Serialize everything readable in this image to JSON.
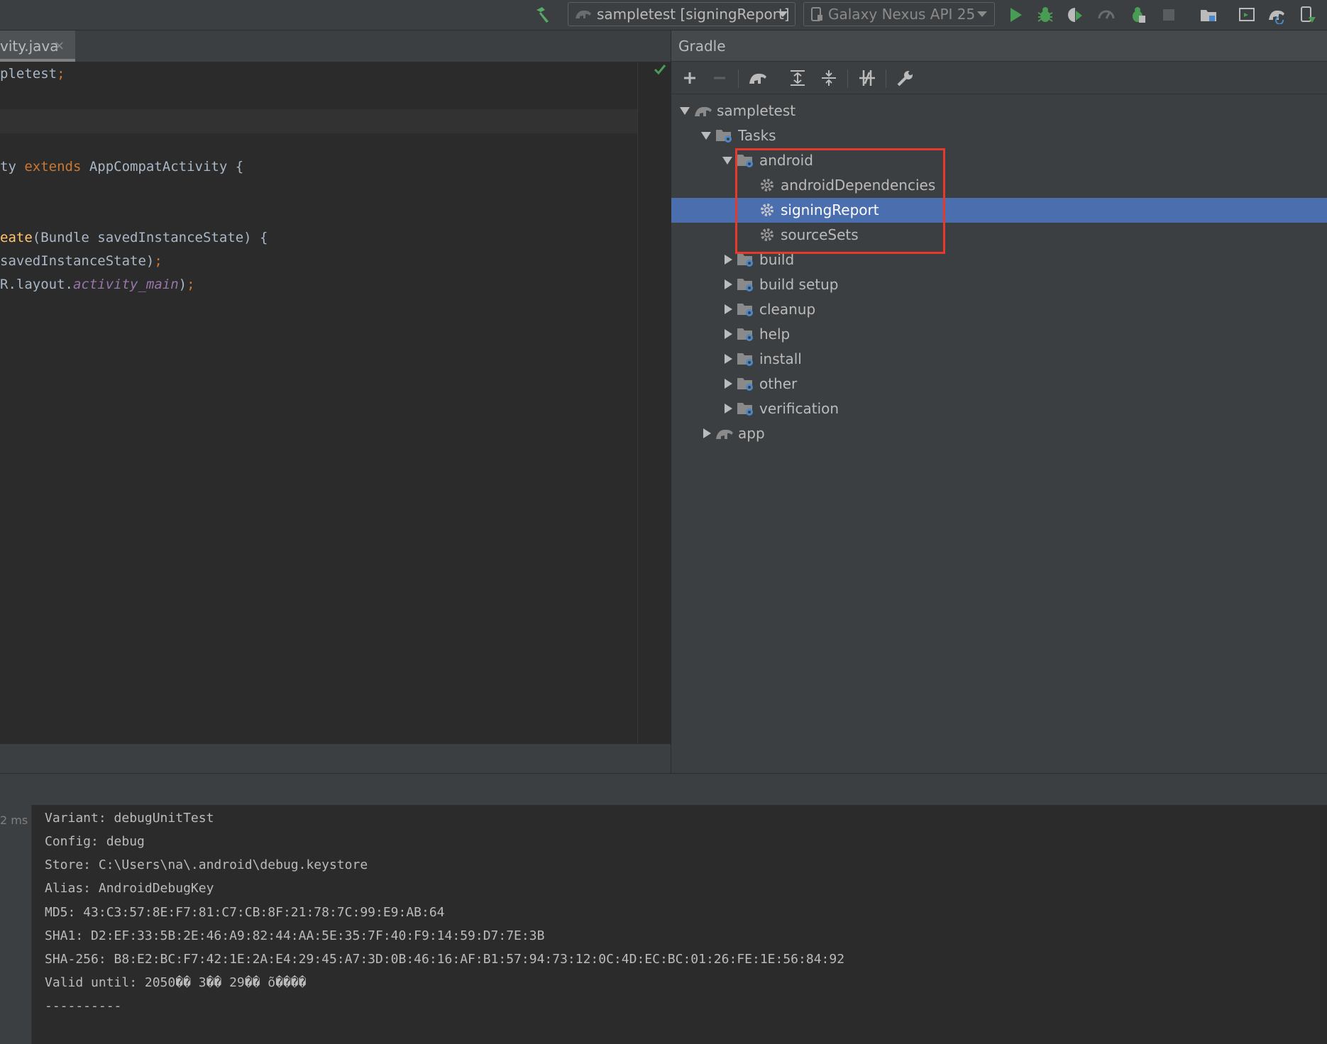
{
  "toolbar": {
    "run_config": "sampletest [signingReport]",
    "device": "Galaxy Nexus API 25"
  },
  "tab": {
    "label": "vity.java",
    "close": "×"
  },
  "editor": {
    "line1": {
      "a": "pletest",
      "b": ";"
    },
    "line2": {
      "a": "ty ",
      "kw": "extends",
      "b": " AppCompatActivity {"
    },
    "line3": {
      "fn": "eate",
      "b": "(Bundle savedInstanceState) {"
    },
    "line4": {
      "a": "savedInstanceState)",
      "b": ";"
    },
    "line5": {
      "a": "R.layout.",
      "it": "activity_main",
      "b": ")",
      "c": ";"
    }
  },
  "gradle": {
    "title": "Gradle",
    "tree": {
      "root": "sampletest",
      "tasks": "Tasks",
      "android": "android",
      "android_children": [
        "androidDependencies",
        "signingReport",
        "sourceSets"
      ],
      "groups": [
        "build",
        "build setup",
        "cleanup",
        "help",
        "install",
        "other",
        "verification"
      ],
      "app": "app"
    },
    "selected": "signingReport"
  },
  "console": {
    "timing": "2 ms",
    "lines": [
      "Variant: debugUnitTest",
      "Config: debug",
      "Store: C:\\Users\\na\\.android\\debug.keystore",
      "Alias: AndroidDebugKey",
      "MD5: 43:C3:57:8E:F7:81:C7:CB:8F:21:78:7C:99:E9:AB:64",
      "SHA1: D2:EF:33:5B:2E:46:A9:82:44:AA:5E:35:7F:40:F9:14:59:D7:7E:3B",
      "SHA-256: B8:E2:BC:F7:42:1E:2A:E4:29:45:A7:3D:0B:46:16:AF:B1:57:94:73:12:0C:4D:EC:BC:01:26:FE:1E:56:84:92",
      "Valid until: 2050�� 3�� 29�� õ����",
      "----------"
    ]
  },
  "colors": {
    "selection": "#4b6eaf",
    "annotation_box": "#e8392b",
    "run_green": "#499c54"
  }
}
